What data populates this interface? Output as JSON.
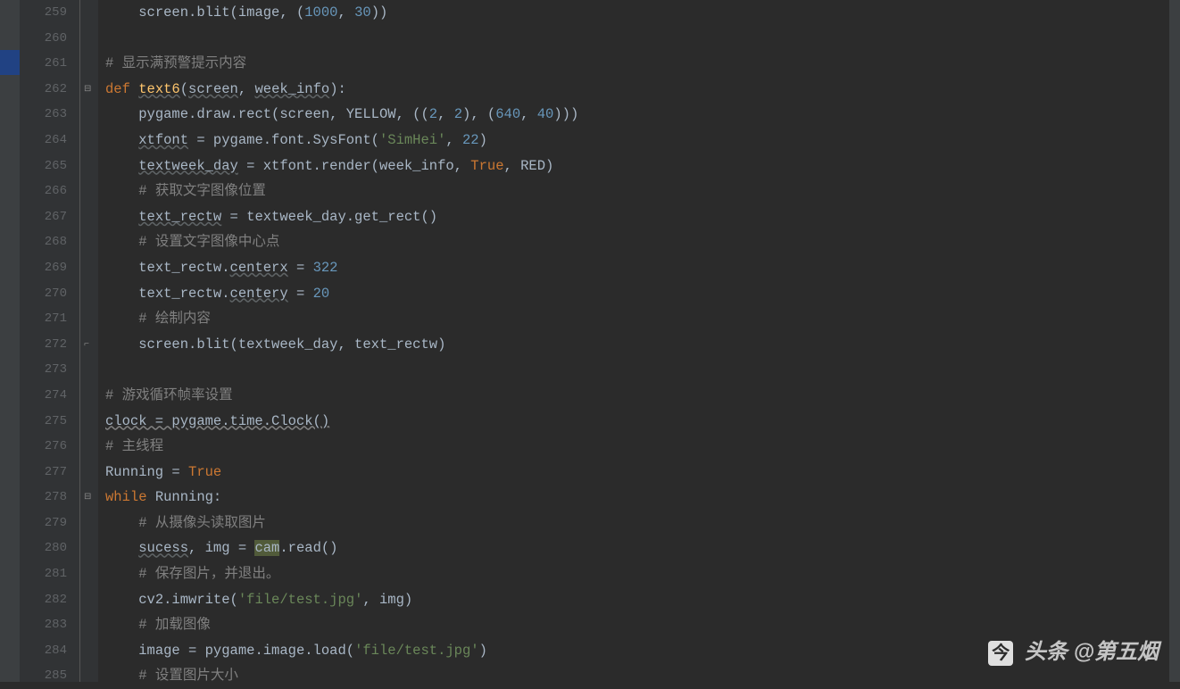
{
  "lines": [
    {
      "n": 259,
      "indent": "    ",
      "tokens": [
        {
          "t": "screen.blit(image, (",
          "c": "fn"
        },
        {
          "t": "1000",
          "c": "num"
        },
        {
          "t": ", ",
          "c": "op"
        },
        {
          "t": "30",
          "c": "num"
        },
        {
          "t": "))",
          "c": "op"
        }
      ]
    },
    {
      "n": 260,
      "indent": "",
      "tokens": []
    },
    {
      "n": 261,
      "indent": "",
      "tokens": [
        {
          "t": "# 显示满预警提示内容",
          "c": "cm"
        }
      ]
    },
    {
      "n": 262,
      "indent": "",
      "fold": "−",
      "tokens": [
        {
          "t": "def ",
          "c": "kw"
        },
        {
          "t": "text6",
          "c": "def-name"
        },
        {
          "t": "(",
          "c": "op"
        },
        {
          "t": "screen",
          "c": "wavy"
        },
        {
          "t": ", ",
          "c": "op"
        },
        {
          "t": "week_info",
          "c": "wavy"
        },
        {
          "t": "):",
          "c": "op"
        }
      ]
    },
    {
      "n": 263,
      "indent": "    ",
      "tokens": [
        {
          "t": "pygame.draw.rect(screen, YELLOW, ((",
          "c": "fn"
        },
        {
          "t": "2",
          "c": "num"
        },
        {
          "t": ", ",
          "c": "op"
        },
        {
          "t": "2",
          "c": "num"
        },
        {
          "t": "), (",
          "c": "op"
        },
        {
          "t": "640",
          "c": "num"
        },
        {
          "t": ", ",
          "c": "op"
        },
        {
          "t": "40",
          "c": "num"
        },
        {
          "t": ")))",
          "c": "op"
        }
      ]
    },
    {
      "n": 264,
      "indent": "    ",
      "tokens": [
        {
          "t": "xtfont",
          "c": "wavy"
        },
        {
          "t": " = pygame.font.SysFont(",
          "c": "fn"
        },
        {
          "t": "'SimHei'",
          "c": "str"
        },
        {
          "t": ", ",
          "c": "op"
        },
        {
          "t": "22",
          "c": "num"
        },
        {
          "t": ")",
          "c": "op"
        }
      ]
    },
    {
      "n": 265,
      "indent": "    ",
      "tokens": [
        {
          "t": "textweek_day",
          "c": "wavy"
        },
        {
          "t": " = xtfont.render(week_info, ",
          "c": "fn"
        },
        {
          "t": "True",
          "c": "kw"
        },
        {
          "t": ", RED)",
          "c": "fn"
        }
      ]
    },
    {
      "n": 266,
      "indent": "    ",
      "tokens": [
        {
          "t": "# 获取文字图像位置",
          "c": "cm"
        }
      ]
    },
    {
      "n": 267,
      "indent": "    ",
      "tokens": [
        {
          "t": "text_rectw",
          "c": "wavy"
        },
        {
          "t": " = textweek_day.get_rect()",
          "c": "fn"
        }
      ]
    },
    {
      "n": 268,
      "indent": "    ",
      "tokens": [
        {
          "t": "# 设置文字图像中心点",
          "c": "cm"
        }
      ]
    },
    {
      "n": 269,
      "indent": "    ",
      "tokens": [
        {
          "t": "text_rectw.",
          "c": "fn"
        },
        {
          "t": "centerx",
          "c": "wavy"
        },
        {
          "t": " = ",
          "c": "op"
        },
        {
          "t": "322",
          "c": "num"
        }
      ]
    },
    {
      "n": 270,
      "indent": "    ",
      "tokens": [
        {
          "t": "text_rectw.",
          "c": "fn"
        },
        {
          "t": "centery",
          "c": "wavy"
        },
        {
          "t": " = ",
          "c": "op"
        },
        {
          "t": "20",
          "c": "num"
        }
      ]
    },
    {
      "n": 271,
      "indent": "    ",
      "tokens": [
        {
          "t": "# 绘制内容",
          "c": "cm"
        }
      ]
    },
    {
      "n": 272,
      "indent": "    ",
      "fold": "⌐",
      "tokens": [
        {
          "t": "screen.blit(textweek_day, text_rectw)",
          "c": "fn"
        }
      ]
    },
    {
      "n": 273,
      "indent": "",
      "tokens": []
    },
    {
      "n": 274,
      "indent": "",
      "tokens": [
        {
          "t": "# 游戏循环帧率设置",
          "c": "cm"
        }
      ]
    },
    {
      "n": 275,
      "indent": "",
      "tokens": [
        {
          "t": "clock = pygame.time.Clock()",
          "c": "wavy-g"
        }
      ]
    },
    {
      "n": 276,
      "indent": "",
      "tokens": [
        {
          "t": "# 主线程",
          "c": "cm"
        }
      ]
    },
    {
      "n": 277,
      "indent": "",
      "tokens": [
        {
          "t": "Running = ",
          "c": "fn"
        },
        {
          "t": "True",
          "c": "kw"
        }
      ]
    },
    {
      "n": 278,
      "indent": "",
      "fold": "−",
      "tokens": [
        {
          "t": "while ",
          "c": "kw"
        },
        {
          "t": "Running:",
          "c": "fn"
        }
      ]
    },
    {
      "n": 279,
      "indent": "    ",
      "tokens": [
        {
          "t": "# 从摄像头读取图片",
          "c": "cm"
        }
      ]
    },
    {
      "n": 280,
      "indent": "    ",
      "tokens": [
        {
          "t": "sucess",
          "c": "wavy"
        },
        {
          "t": ", img = ",
          "c": "fn"
        },
        {
          "t": "cam",
          "c": "hl-bg"
        },
        {
          "t": ".read()",
          "c": "fn"
        }
      ]
    },
    {
      "n": 281,
      "indent": "    ",
      "tokens": [
        {
          "t": "# 保存图片，并退出。",
          "c": "cm"
        }
      ]
    },
    {
      "n": 282,
      "indent": "    ",
      "tokens": [
        {
          "t": "cv2.imwrite(",
          "c": "fn"
        },
        {
          "t": "'file/test.jpg'",
          "c": "str"
        },
        {
          "t": ", img)",
          "c": "fn"
        }
      ]
    },
    {
      "n": 283,
      "indent": "    ",
      "tokens": [
        {
          "t": "# 加载图像",
          "c": "cm"
        }
      ]
    },
    {
      "n": 284,
      "indent": "    ",
      "tokens": [
        {
          "t": "image = pygame.image.load(",
          "c": "fn"
        },
        {
          "t": "'file/test.jpg'",
          "c": "str"
        },
        {
          "t": ")",
          "c": "op"
        }
      ]
    },
    {
      "n": 285,
      "indent": "    ",
      "tokens": [
        {
          "t": "# 设置图片大小",
          "c": "cm"
        }
      ]
    }
  ],
  "watermark": {
    "prefix": "头条",
    "handle": "@第五烟"
  }
}
